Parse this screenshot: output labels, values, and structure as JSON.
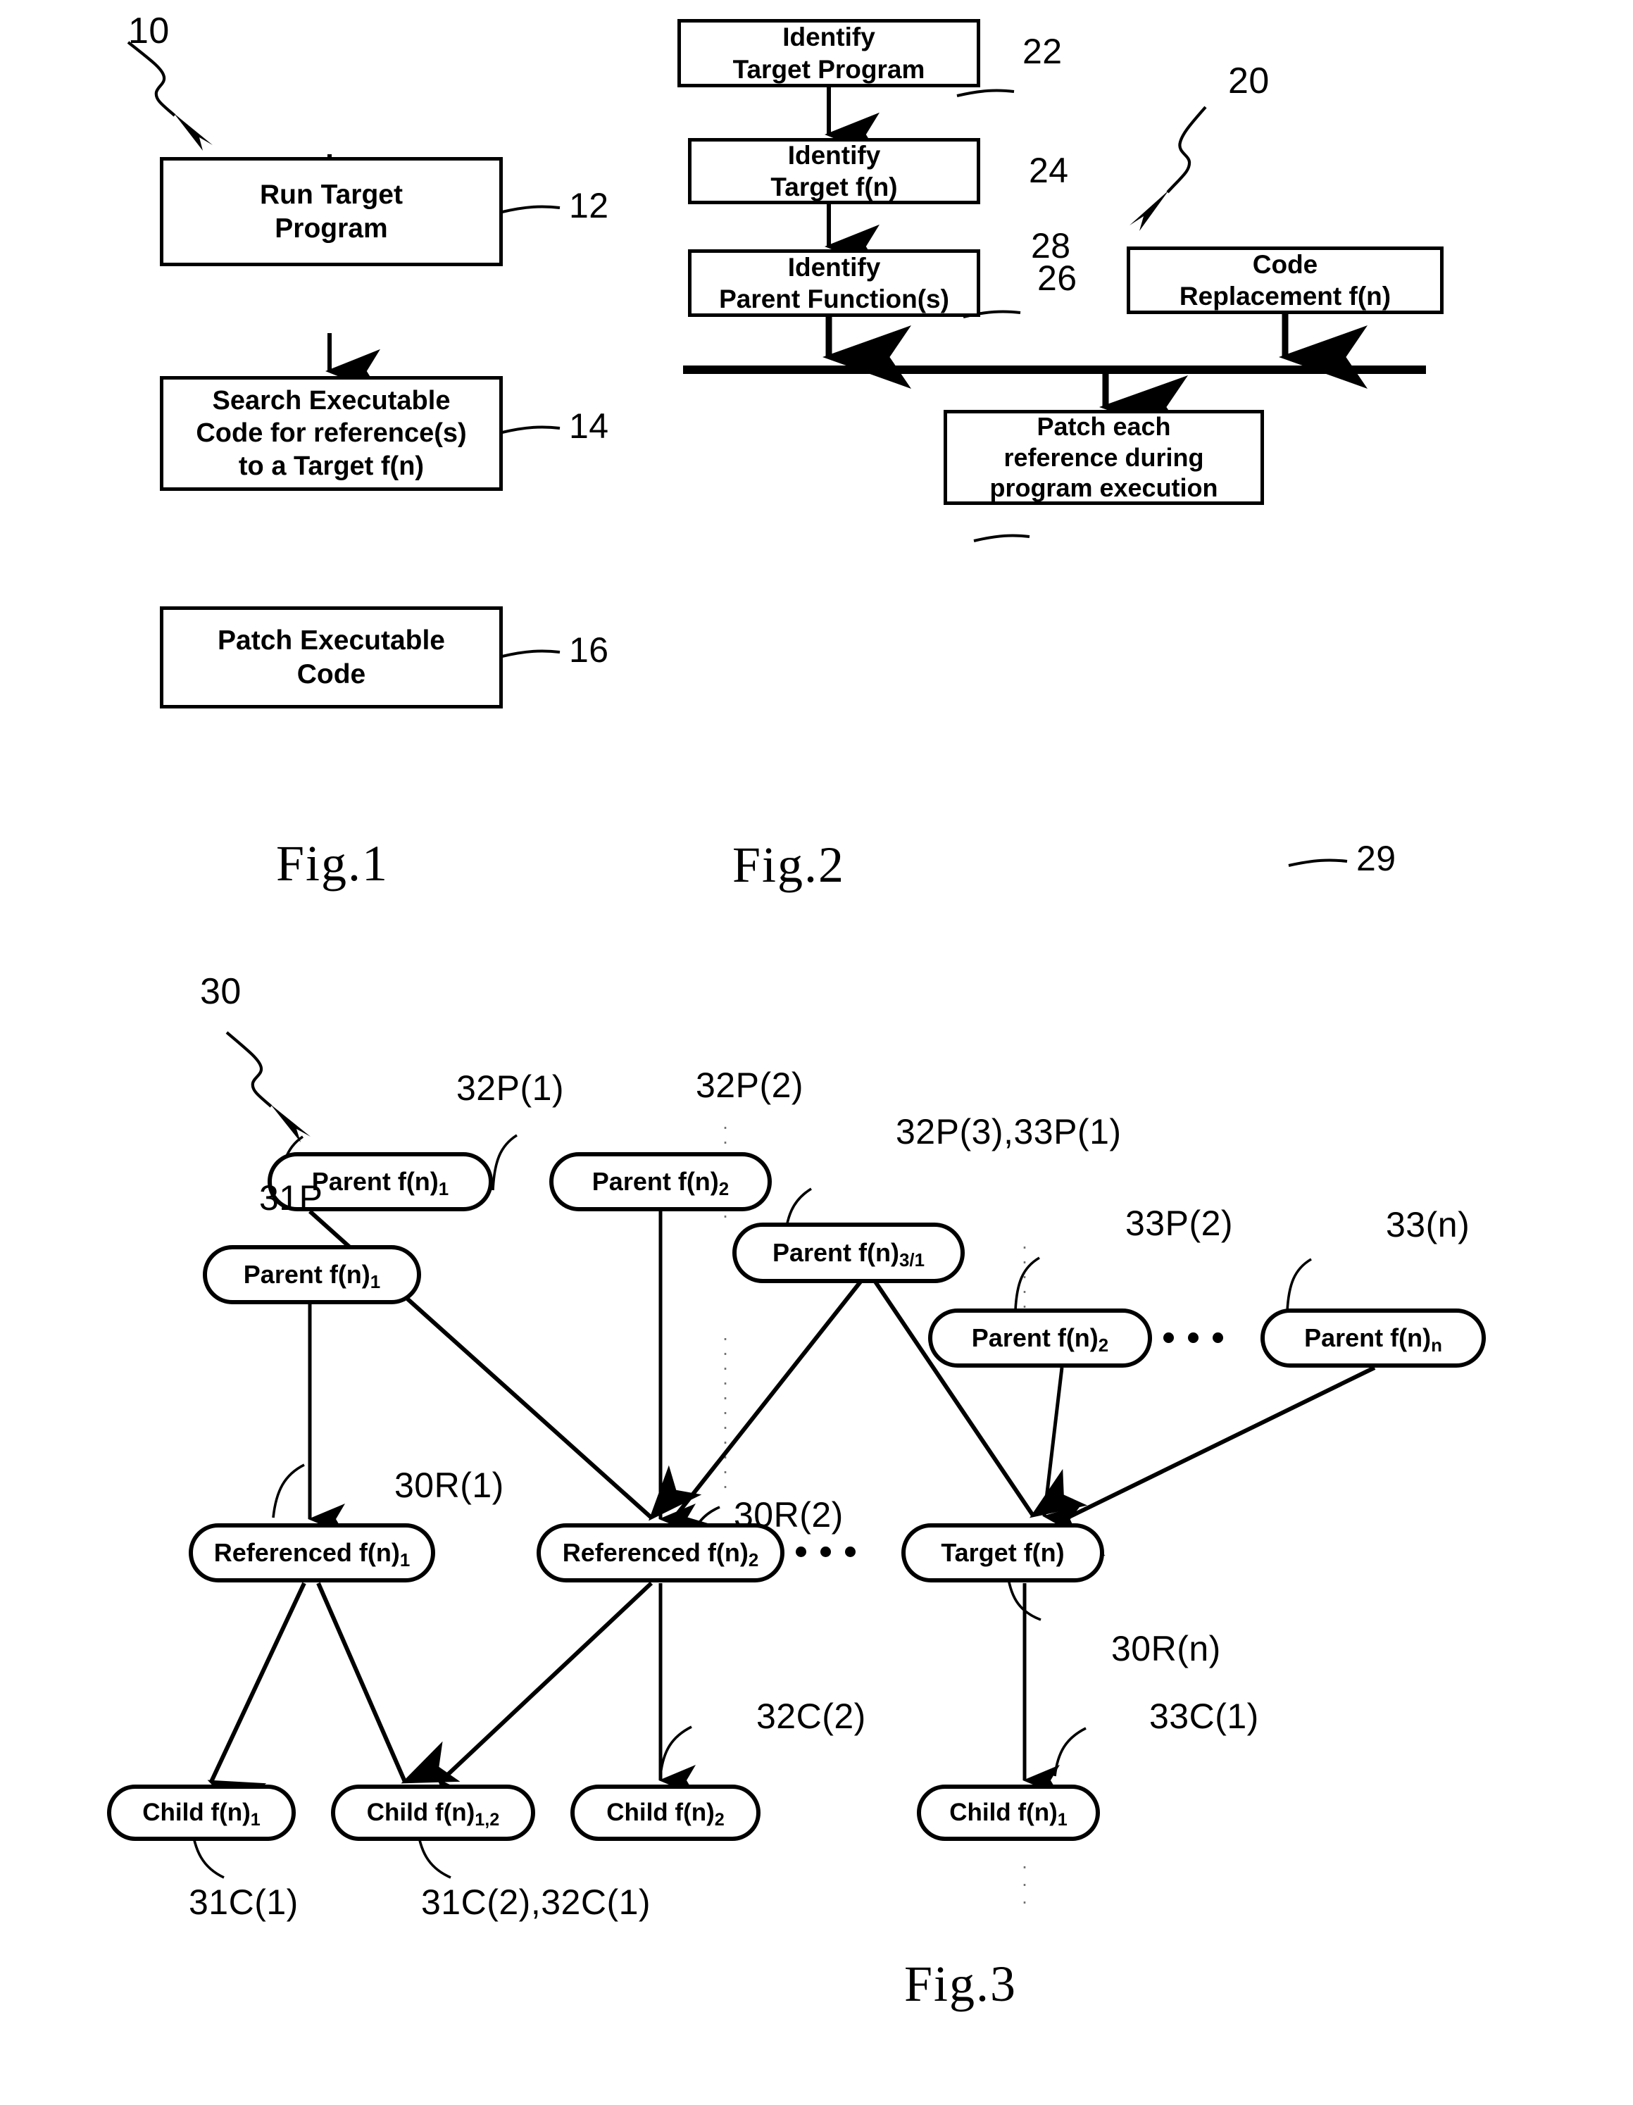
{
  "figures": {
    "fig1": {
      "caption": "Fig.1",
      "numeral": "10",
      "steps": [
        {
          "id": "12",
          "lines": [
            "Run Target",
            "Program"
          ],
          "numeral": "12"
        },
        {
          "id": "14",
          "lines": [
            "Search Executable",
            "Code for reference(s)",
            "to a Target f(n)"
          ],
          "numeral": "14"
        },
        {
          "id": "16",
          "lines": [
            "Patch Executable",
            "Code"
          ],
          "numeral": "16"
        }
      ]
    },
    "fig2": {
      "caption": "Fig.2",
      "numeral": "20",
      "steps": [
        {
          "id": "22",
          "lines": [
            "Identify",
            "Target Program"
          ],
          "numeral": "22"
        },
        {
          "id": "24",
          "lines": [
            "Identify",
            "Target f(n)"
          ],
          "numeral": "24"
        },
        {
          "id": "26",
          "lines": [
            "Identify",
            "Parent Function(s)"
          ],
          "numeral": "26"
        },
        {
          "id": "28",
          "lines": [
            "Code",
            "Replacement f(n)"
          ],
          "numeral": "28"
        },
        {
          "id": "29",
          "lines": [
            "Patch each",
            "reference during",
            "program execution"
          ],
          "numeral": "29"
        }
      ]
    },
    "fig3": {
      "caption": "Fig.3",
      "numeral": "30",
      "nodes": {
        "p32_1": {
          "base": "Parent f(n)",
          "sub": "1"
        },
        "p32_2": {
          "base": "Parent f(n)",
          "sub": "2"
        },
        "p31": {
          "base": "Parent f(n)",
          "sub": "1"
        },
        "p32_3": {
          "base": "Parent f(n)",
          "sub": "3/1"
        },
        "p33_2": {
          "base": "Parent f(n)",
          "sub": "2"
        },
        "p33_n": {
          "base": "Parent f(n)",
          "sub": "n"
        },
        "r30_1": {
          "base": "Referenced f(n)",
          "sub": "1"
        },
        "r30_2": {
          "base": "Referenced f(n)",
          "sub": "2"
        },
        "target": {
          "base": "Target f(n)",
          "sub": ""
        },
        "c31_1": {
          "base": "Child f(n)",
          "sub": "1"
        },
        "c31_2": {
          "base": "Child f(n)",
          "sub": "1,2"
        },
        "c32_2": {
          "base": "Child f(n)",
          "sub": "2"
        },
        "c33_1": {
          "base": "Child f(n)",
          "sub": "1"
        }
      },
      "numerals": {
        "n30": "30",
        "n32P1": "32P(1)",
        "n32P2": "32P(2)",
        "n31P": "31P",
        "n32P3_33P1": "32P(3),33P(1)",
        "n33P2": "33P(2)",
        "n33n": "33(n)",
        "n30R1": "30R(1)",
        "n30R2": "30R(2)",
        "n30Rn": "30R(n)",
        "n31C1": "31C(1)",
        "n31C2_32C1": "31C(2),32C(1)",
        "n32C2": "32C(2)",
        "n33C1": "33C(1)"
      }
    }
  },
  "colors": {
    "ink": "#000000",
    "paper": "#ffffff"
  }
}
